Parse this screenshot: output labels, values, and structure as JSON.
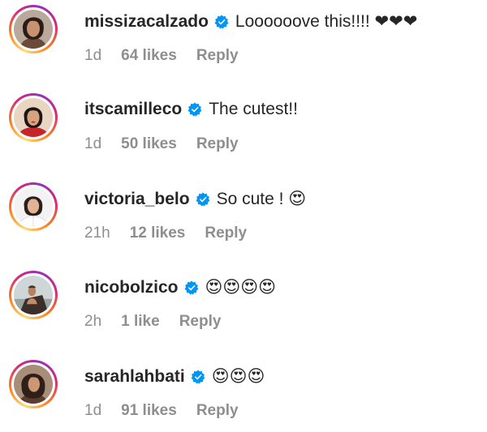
{
  "comments": [
    {
      "username": "missizacalzado",
      "text": "Loooooove this!!!! ❤❤❤",
      "time": "1d",
      "likes": "64 likes",
      "reply_label": "Reply",
      "avatar_icon": "profile-photo-woman-dark-hair"
    },
    {
      "username": "itscamilleco",
      "text": "The cutest!!",
      "time": "1d",
      "likes": "50 likes",
      "reply_label": "Reply",
      "avatar_icon": "profile-photo-woman-red-top"
    },
    {
      "username": "victoria_belo",
      "text": "So cute ! 😍",
      "time": "21h",
      "likes": "12 likes",
      "reply_label": "Reply",
      "avatar_icon": "profile-photo-woman-white-coat"
    },
    {
      "username": "nicobolzico",
      "text": "😍😍😍😍",
      "time": "2h",
      "likes": "1 like",
      "reply_label": "Reply",
      "avatar_icon": "profile-photo-man-outdoors"
    },
    {
      "username": "sarahlahbati",
      "text": "😍😍😍",
      "time": "1d",
      "likes": "91 likes",
      "reply_label": "Reply",
      "avatar_icon": "profile-photo-woman-long-hair"
    }
  ],
  "colors": {
    "text_primary": "#262626",
    "text_secondary": "#8e8e8e",
    "verified_blue": "#0095f6",
    "heart_black": "#262626"
  },
  "icons": {
    "verified": "verified-badge-icon"
  }
}
